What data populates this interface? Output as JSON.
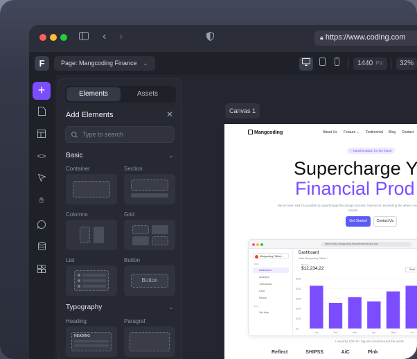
{
  "browser": {
    "url": "https://www.coding.com"
  },
  "toolbar": {
    "page_label": "Page: Mangcoding Finance",
    "width_value": "1440",
    "width_unit": "PX",
    "zoom": "32%"
  },
  "panel": {
    "tabs": [
      {
        "label": "Elements"
      },
      {
        "label": "Assets"
      }
    ],
    "title": "Add Elements",
    "search_placeholder": "Type to search",
    "sections": {
      "basic": "Basic",
      "typography": "Typography"
    },
    "items": {
      "container": "Container",
      "section": "Section",
      "columns": "Colomns",
      "grid": "Grid",
      "list": "List",
      "button": "Button",
      "heading": "Heading",
      "paragraph": "Paragraf"
    },
    "button_preview_label": "Button",
    "heading_preview_label": "HEADING"
  },
  "canvas": {
    "label": "Canvas 1"
  },
  "site": {
    "brand": "Mangcoding",
    "nav": [
      "About Us",
      "Feature ⌄",
      "Testimonial",
      "Blog",
      "Contact"
    ],
    "pill": "+ Transformation for the future",
    "hero_line1": "Supercharge Y",
    "hero_line2": "Financial Prod",
    "hero_sub": "We've been told it's possible to supercharge the design process. Instead of reinventing the wheel, exceptional results.",
    "cta_primary": "Get Started",
    "cta_secondary": "Contact Us",
    "footer_note": "Loved by 100.00+ big and small around the world",
    "brands": [
      "Reflect",
      "SHIPSS",
      "AiC",
      "Plnk"
    ]
  },
  "mockup": {
    "url": "https://www.mangcoding-financeindashboard.com",
    "org": "Mangcoding Official ⌄",
    "menu_label": "Menu",
    "items": [
      "Dashboard",
      "Analytics",
      "Transaction",
      "Card",
      "Report"
    ],
    "help_label": "Help",
    "help_items": [
      "Get Help"
    ],
    "title": "Dashboard",
    "subtitle": "Hello Mangcoding Official !",
    "balance_label": "Balance",
    "balance": "$12,234,22",
    "filter_label": "Short"
  },
  "chart_data": {
    "type": "bar",
    "categories": [
      "Jan",
      "Feb",
      "Mar",
      "Apr",
      "May",
      "Jun"
    ],
    "values": [
      300,
      180,
      220,
      190,
      260,
      300
    ],
    "ylabels": [
      "$0",
      "$150",
      "$200",
      "$250",
      "$300",
      "$350"
    ],
    "ylim": [
      0,
      350
    ],
    "color": "#7c4dff"
  },
  "colors": {
    "accent": "#7c4dff",
    "cta": "#5b5bf6"
  }
}
